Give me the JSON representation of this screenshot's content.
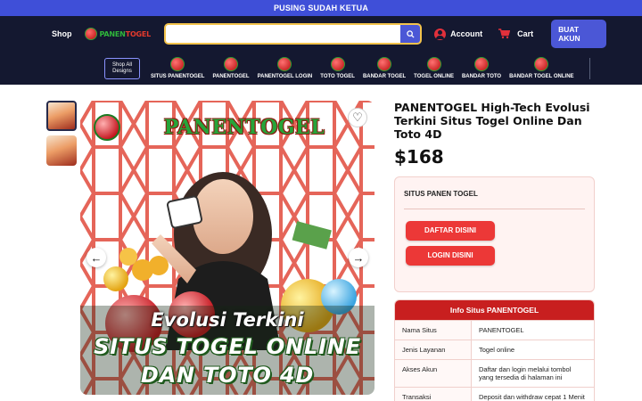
{
  "announcement": "PUSING SUDAH KETUA",
  "header": {
    "shop_label": "Shop",
    "logo_text_green": "PANEN",
    "logo_text_red": "TOGEL",
    "search_placeholder": "",
    "account_label": "Account",
    "cart_label": "Cart",
    "register_label": "BUAT AKUN"
  },
  "nav": {
    "all_designs": "Shop All Designs",
    "items": [
      "SITUS PANENTOGEL",
      "PANENTOGEL",
      "PANENTOGEL LOGIN",
      "TOTO TOGEL",
      "BANDAR TOGEL",
      "TOGEL ONLINE",
      "BANDAR TOTO",
      "BANDAR TOGEL ONLINE"
    ]
  },
  "hero": {
    "title": "PANENTOGEL",
    "line1": "Evolusi Terkini",
    "line2": "SITUS TOGEL ONLINE",
    "line3": "DAN TOTO 4D",
    "prev_glyph": "←",
    "next_glyph": "→",
    "heart_glyph": "♡"
  },
  "product": {
    "title": "PANENTOGEL High-Tech Evolusi Terkini Situs Togel Online Dan Toto 4D",
    "price": "$168",
    "card_title": "SITUS PANEN TOGEL",
    "btn_daftar": "DAFTAR DISINI",
    "btn_login": "LOGIN DISINI"
  },
  "info_table": {
    "heading": "Info Situs PANENTOGEL",
    "rows": [
      {
        "k": "Nama Situs",
        "v": "PANENTOGEL"
      },
      {
        "k": "Jenis Layanan",
        "v": "Togel online"
      },
      {
        "k": "Akses Akun",
        "v": "Daftar dan login melalui tombol yang tersedia di halaman ini"
      },
      {
        "k": "Transaksi",
        "v": "Deposit dan withdraw cepat 1 Menit"
      }
    ]
  },
  "colors": {
    "announce_bg": "#3f4fd8",
    "header_bg": "#141830",
    "accent_blue": "#4b57d6",
    "cta_red": "#ec3837",
    "table_head_red": "#c81f1f"
  }
}
